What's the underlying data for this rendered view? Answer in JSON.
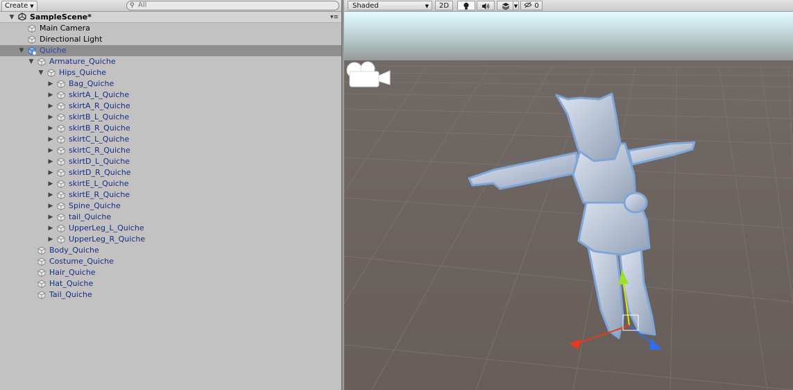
{
  "hierarchy": {
    "create_label": "Create",
    "search_placeholder": "All",
    "scene_name": "SampleScene*",
    "rows": [
      {
        "label": "Main Camera",
        "depth": 1,
        "arrow": "",
        "style": "normal"
      },
      {
        "label": "Directional Light",
        "depth": 1,
        "arrow": "",
        "style": "normal"
      },
      {
        "label": "Quiche",
        "depth": 1,
        "arrow": "down",
        "style": "selected"
      },
      {
        "label": "Armature_Quiche",
        "depth": 2,
        "arrow": "down",
        "style": "blue"
      },
      {
        "label": "Hips_Quiche",
        "depth": 3,
        "arrow": "down",
        "style": "blue"
      },
      {
        "label": "Bag_Quiche",
        "depth": 4,
        "arrow": "right",
        "style": "blue"
      },
      {
        "label": "skirtA_L_Quiche",
        "depth": 4,
        "arrow": "right",
        "style": "blue"
      },
      {
        "label": "skirtA_R_Quiche",
        "depth": 4,
        "arrow": "right",
        "style": "blue"
      },
      {
        "label": "skirtB_L_Quiche",
        "depth": 4,
        "arrow": "right",
        "style": "blue"
      },
      {
        "label": "skirtB_R_Quiche",
        "depth": 4,
        "arrow": "right",
        "style": "blue"
      },
      {
        "label": "skirtC_L_Quiche",
        "depth": 4,
        "arrow": "right",
        "style": "blue"
      },
      {
        "label": "skirtC_R_Quiche",
        "depth": 4,
        "arrow": "right",
        "style": "blue"
      },
      {
        "label": "skirtD_L_Quiche",
        "depth": 4,
        "arrow": "right",
        "style": "blue"
      },
      {
        "label": "skirtD_R_Quiche",
        "depth": 4,
        "arrow": "right",
        "style": "blue"
      },
      {
        "label": "skirtE_L_Quiche",
        "depth": 4,
        "arrow": "right",
        "style": "blue"
      },
      {
        "label": "skirtE_R_Quiche",
        "depth": 4,
        "arrow": "right",
        "style": "blue"
      },
      {
        "label": "Spine_Quiche",
        "depth": 4,
        "arrow": "right",
        "style": "blue"
      },
      {
        "label": "tail_Quiche",
        "depth": 4,
        "arrow": "right",
        "style": "blue"
      },
      {
        "label": "UpperLeg_L_Quiche",
        "depth": 4,
        "arrow": "right",
        "style": "blue"
      },
      {
        "label": "UpperLeg_R_Quiche",
        "depth": 4,
        "arrow": "right",
        "style": "blue"
      },
      {
        "label": "Body_Quiche",
        "depth": 2,
        "arrow": "",
        "style": "blue"
      },
      {
        "label": "Costume_Quiche",
        "depth": 2,
        "arrow": "",
        "style": "blue"
      },
      {
        "label": "Hair_Quiche",
        "depth": 2,
        "arrow": "",
        "style": "blue"
      },
      {
        "label": "Hat_Quiche",
        "depth": 2,
        "arrow": "",
        "style": "blue"
      },
      {
        "label": "Tail_Quiche",
        "depth": 2,
        "arrow": "",
        "style": "blue"
      }
    ]
  },
  "scene_view": {
    "shading_mode": "Shaded",
    "mode_2d_label": "2D",
    "hidden_count": "0",
    "icons": {
      "lighting": "lightbulb-icon",
      "audio": "speaker-icon",
      "effects": "layers-icon",
      "visibility": "eye-slash-icon",
      "camera_gizmo": "camera-gizmo-icon"
    }
  },
  "colors": {
    "panel_bg": "#c2c2c2",
    "selected_row": "#8f8f8f",
    "prefab_text": "#152f83",
    "ground": "#6a625e",
    "sky": "#e6fbfd",
    "gizmo_x": "#e8391c",
    "gizmo_y": "#9ee02b",
    "gizmo_z": "#2f6df0"
  }
}
